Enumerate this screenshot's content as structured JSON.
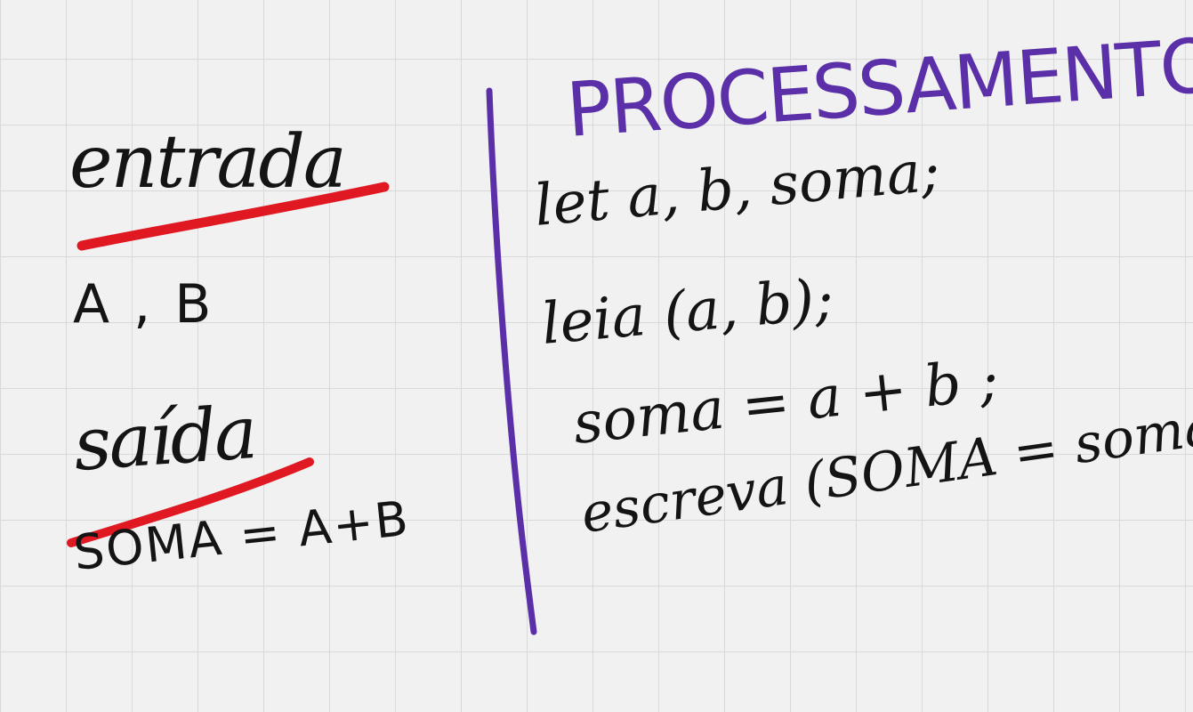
{
  "left_column": {
    "heading_input": "entrada",
    "input_values": "A , B",
    "heading_output": "saída",
    "output_formula": "SOMA = A+B"
  },
  "right_column": {
    "heading": "PROCESSAMENTO",
    "code_lines": [
      "let a, b, soma;",
      "leia (a, b);",
      "soma = a + b ;",
      "escreva (SOMA = soma) ;"
    ]
  },
  "colors": {
    "ink": "#141414",
    "underline": "#e01822",
    "divider": "#5a2fa8",
    "heading_purple": "#5a2fa8",
    "grid": "#d9d9d9",
    "background": "#f1f1f1"
  }
}
